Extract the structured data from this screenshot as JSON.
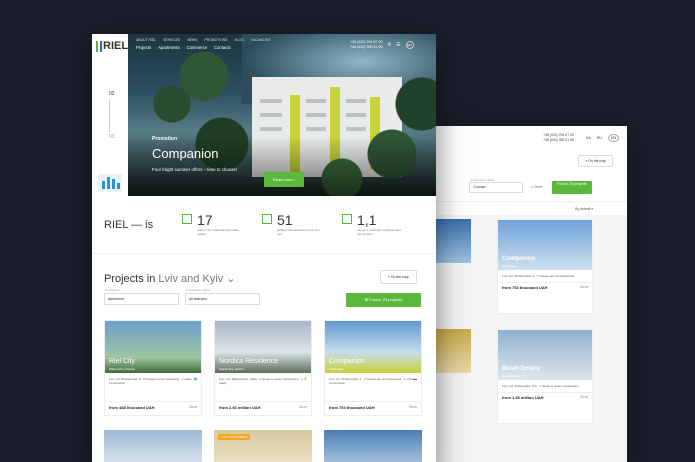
{
  "front": {
    "logo": "RIEL",
    "nav_top": [
      "ABOUT RIEL",
      "SERVICES",
      "NEWS",
      "PROMOTIONS",
      "BLOG",
      "VACANCIES"
    ],
    "nav_main": [
      "Projects",
      "Apartments",
      "Commerce",
      "Contacts"
    ],
    "phones": [
      "+38 (032) 294 67 00",
      "+38 (044) 390 21 50"
    ],
    "lang_badge": "EN",
    "slide_current": "02",
    "slide_next": "03",
    "promo_kicker": "Promotion",
    "promo_title": "Companion",
    "promo_sub": "Four bright summer offers – time to choose!",
    "more_button": "Read more",
    "brand_is": "RIEL — is",
    "stats": [
      {
        "value": "17",
        "text": "years in the residential real estate market"
      },
      {
        "value": "51",
        "text": "facilities commissioned in Lviv and Kyiv"
      },
      {
        "value": "1,1",
        "text": "mln sq.m of already completed and new projects"
      }
    ],
    "projects_title": "Projects in",
    "projects_cities": "Lviv and Kyiv",
    "map_button": "On the map",
    "filter1_caption": "Fe category",
    "filter1_value": "apartment",
    "filter2_caption": "Construction status",
    "filter2_value": "all statuses",
    "found_button": "Found: 23 projects",
    "cards": [
      {
        "name": "Riel City",
        "district": "Zaliznychnyi district",
        "info": "Lviv, vul. Rudnens'ka, 8 · 3 houses in commissioning · 1 under construction",
        "price": "from 488 thousand UAH",
        "go": "Go to"
      },
      {
        "name": "Nordica Residence",
        "district": "Frankivskyi district",
        "info": "Kyiv, vul. Zabolotnoho, 148a · 1 house is under construction · 1 ready",
        "price": "from 2.66 million UAH",
        "go": "Go to"
      },
      {
        "name": "Companion",
        "district": "Sykhivskyi",
        "info": "Lviv, vul. Shuhevycha, 2 · 7 houses are commissioned · 1 under construction",
        "price": "from 753 thousand UAH",
        "go": "Go to"
      }
    ],
    "tag_label": "LAST APARTMENTS"
  },
  "back": {
    "phones": [
      "+38 (032) 294 67 00",
      "+38 (044) 390 21 50"
    ],
    "langs": [
      "UA",
      "RU",
      "EN"
    ],
    "map_button": "On the map",
    "status_caption": "Construction status",
    "status_value": "Choose",
    "clear": "Clear",
    "found_button": "Found: 23 projects",
    "sort": "By default",
    "cards": [
      {
        "name": "Companion",
        "district": "Sykhivskyi",
        "info": "Lviv, vul. Shuhevycha, 2 · 7 houses are commissioned",
        "price": "from 753 thousand UAH",
        "go": "Go to"
      },
      {
        "name": "Bereh Dnipra",
        "district": "Darnytskyi district",
        "info": "Kyiv, vul. Kolomyiska, 17a · 1 house is under construction",
        "price": "from 1.35 million UAH",
        "go": "Go to"
      }
    ]
  }
}
